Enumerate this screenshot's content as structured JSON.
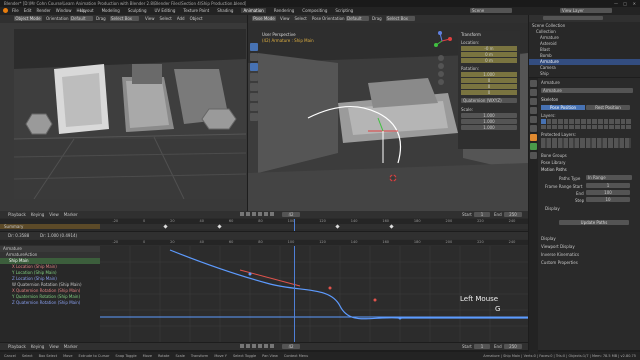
{
  "window": {
    "title": "Blender* [D:\\Mr Cohn Course\\Learn Animation Production with Blender 2.8\\Blender Files\\Section 4\\Ship Production.blend]",
    "controls": [
      "—",
      "□",
      "✕"
    ]
  },
  "topbar": {
    "menus": [
      "File",
      "Edit",
      "Render",
      "Window",
      "Help"
    ],
    "workspaces": [
      "Layout",
      "Modeling",
      "Sculpting",
      "UV Editing",
      "Texture Paint",
      "Shading",
      "Animation",
      "Rendering",
      "Compositing",
      "Scripting"
    ],
    "active_workspace": "Animation",
    "scene": "Scene",
    "view_layer": "View Layer"
  },
  "left_viewport": {
    "mode": "Object Mode",
    "orientation": "Orientation",
    "orientation_value": "Default",
    "drag": "Drag",
    "select": "Select Box",
    "menus": [
      "View",
      "Select",
      "Add",
      "Object"
    ],
    "camera_label": "Camera"
  },
  "right_viewport": {
    "mode": "Pose Mode",
    "orientation": "Orientation",
    "orientation_value": "Default",
    "drag": "Drag",
    "select": "Select Box",
    "menus": [
      "View",
      "Select",
      "Pose"
    ],
    "persp_label": "User Perspective",
    "selection_label": "(42) Armature : Ship Main",
    "transform": {
      "title": "Transform",
      "location_label": "Location:",
      "location": [
        "-0 m",
        "0 m",
        "0 m"
      ],
      "rotation_label": "Rotation:",
      "rotation": [
        "1.000",
        "0",
        "0",
        "0"
      ],
      "rotation_mode": "Quaternion (WXYZ)",
      "scale_label": "Scale:",
      "scale": [
        "1.000",
        "1.000",
        "1.000"
      ]
    }
  },
  "outliner": {
    "search_placeholder": "",
    "items": [
      {
        "label": "Scene Collection",
        "indent": 0
      },
      {
        "label": "Collection",
        "indent": 1
      },
      {
        "label": "Armature",
        "indent": 2
      },
      {
        "label": "Asteroid",
        "indent": 2
      },
      {
        "label": "Blast",
        "indent": 2
      },
      {
        "label": "Bomb",
        "indent": 2
      },
      {
        "label": "Armature",
        "indent": 2,
        "selected": true
      },
      {
        "label": "Camera",
        "indent": 2
      },
      {
        "label": "Ship",
        "indent": 2
      }
    ]
  },
  "properties": {
    "object_name": "Armature",
    "data_name": "Armature",
    "skeleton_title": "Skeleton",
    "pose_position": "Pose Position",
    "rest_position": "Rest Position",
    "layers_label": "Layers:",
    "protected_label": "Protected Layers:",
    "bone_groups": "Bone Groups",
    "pose_library": "Pose Library",
    "motion_paths": "Motion Paths",
    "paths_type_label": "Paths Type",
    "paths_type": "In Range",
    "frame_range_start_label": "Frame Range Start",
    "frame_range_start": "1",
    "end_label": "End",
    "end": "100",
    "step_label": "Step",
    "step": "10",
    "display_label": "Display",
    "update_paths": "Update Paths",
    "sections": [
      "Display",
      "Viewport Display",
      "Inverse Kinematics",
      "Custom Properties"
    ]
  },
  "dopesheet": {
    "header": [
      "Playback",
      "Keying",
      "View",
      "Marker"
    ],
    "start_label": "Start",
    "start": "1",
    "end_label": "End",
    "end": "250",
    "frame": "42",
    "summary": "Summary",
    "ticks": [
      "-20",
      "0",
      "20",
      "40",
      "60",
      "80",
      "100",
      "120",
      "140",
      "160",
      "180",
      "200",
      "220",
      "240"
    ]
  },
  "graph_editor": {
    "mode_label": "Dr: 0.3588",
    "channel_value": "Dr: 1.000 (0.4914)",
    "channels": [
      {
        "label": "Armature",
        "color": "#c0c0c0"
      },
      {
        "label": "ArmatureAction",
        "color": "#c0c0c0"
      },
      {
        "label": "Ship Main",
        "color": "#c0c0c0",
        "selected": true
      },
      {
        "label": "X Location (Ship Main)",
        "color": "#e06060"
      },
      {
        "label": "Y Location (Ship Main)",
        "color": "#60c060"
      },
      {
        "label": "Z Location (Ship Main)",
        "color": "#6080e0"
      },
      {
        "label": "W Quaternion Rotation (Ship Main)",
        "color": "#c0c0c0"
      },
      {
        "label": "X Quaternion Rotation (Ship Main)",
        "color": "#e06060"
      },
      {
        "label": "Y Quaternion Rotation (Ship Main)",
        "color": "#60c060"
      },
      {
        "label": "Z Quaternion Rotation (Ship Main)",
        "color": "#6080e0"
      }
    ],
    "ticks": [
      "-20",
      "0",
      "20",
      "40",
      "60",
      "80",
      "100",
      "120",
      "140",
      "160",
      "180",
      "200",
      "220",
      "240"
    ],
    "overlay_hint": "Left Mouse",
    "overlay_key": "G"
  },
  "bottom_timeline": {
    "header": [
      "Playback",
      "Keying",
      "View",
      "Marker"
    ],
    "frame": "42",
    "start_label": "Start",
    "start": "1",
    "end_label": "End",
    "end": "250"
  },
  "statusbar": {
    "items": [
      "Cancel",
      "Select",
      "Box Select",
      "Move",
      "Extrude to Cursor",
      "Snap Toggle",
      "Move",
      "Rotate",
      "Scale",
      "Transform",
      "Move Y",
      "Select Toggle",
      "Pan View",
      "Context Menu"
    ],
    "right": "Armature | Ship Main | Verts:0 | Faces:0 | Tris:0 | Objects:1/7 | Mem: 78.5 MB | v2.80.75"
  },
  "colors": {
    "accent_blue": "#4772b3",
    "frame_marker": "#4f7fd6",
    "curve_blue": "#5d9bff",
    "curve_red": "#e2534c",
    "panel_yellow": "#7a7440"
  }
}
